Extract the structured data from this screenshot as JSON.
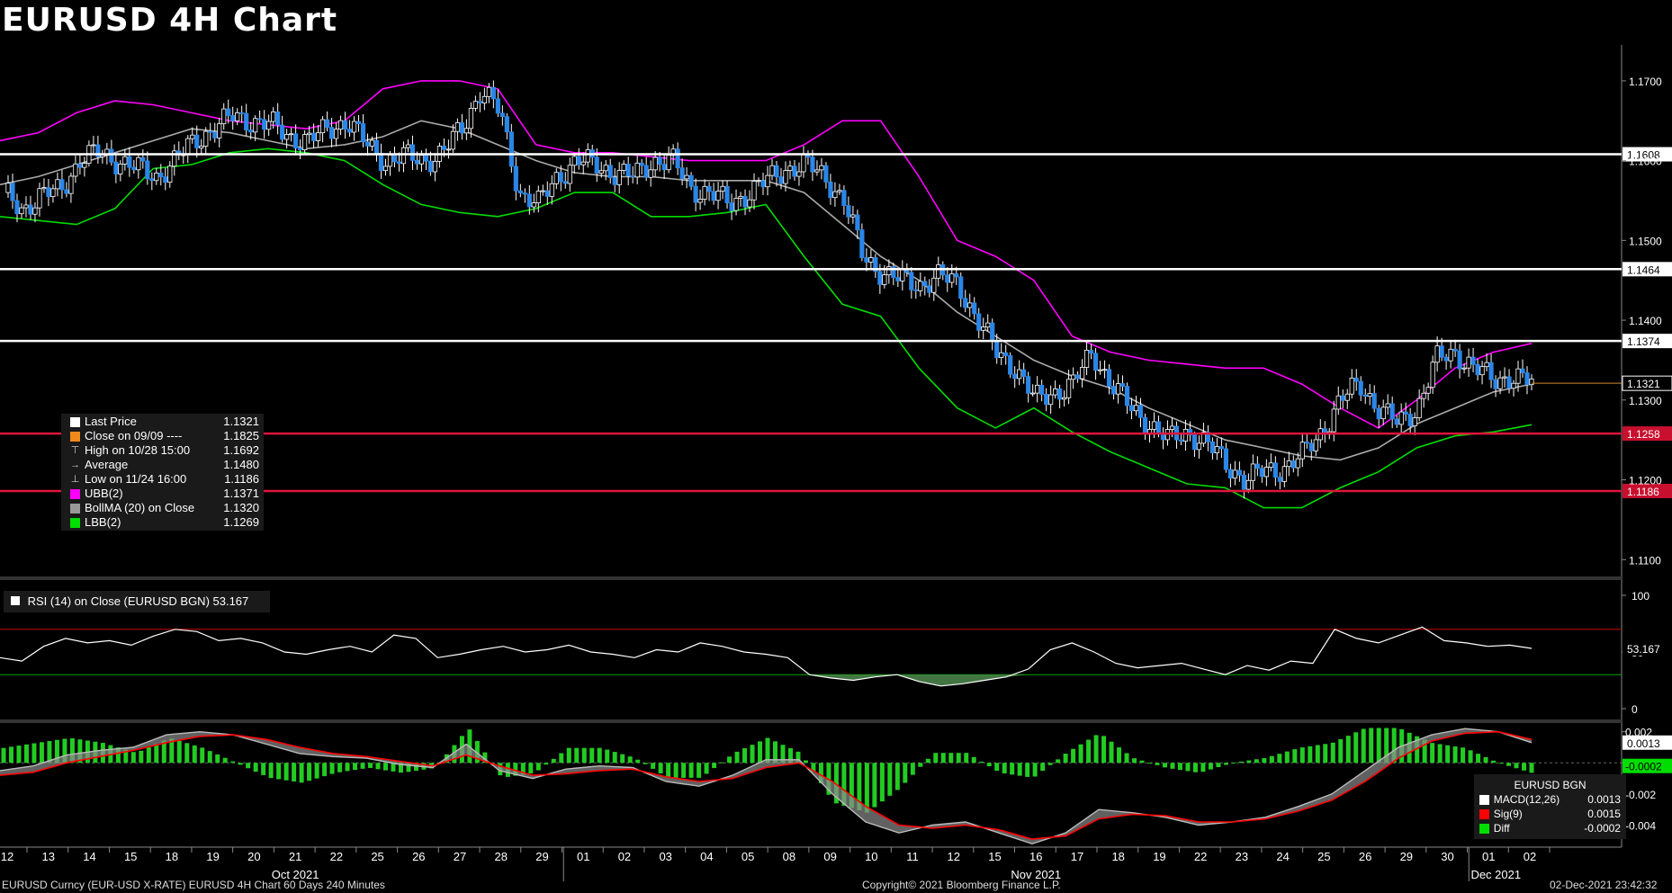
{
  "title": "EURUSD 4H Chart",
  "footer": {
    "left": "EURUSD Curncy (EUR-USD X-RATE) EURUSD 4H Chart 60 Days 240 Minutes",
    "center": "Copyright© 2021 Bloomberg Finance L.P.",
    "right": "02-Dec-2021 23:42:32"
  },
  "colors": {
    "up": "#ffffff",
    "down": "#2b86e6",
    "ubb": "#ff00ff",
    "lbb": "#00dd00",
    "bollma": "#aaaaaa",
    "hline": "#ffffff",
    "support": "#e0143c",
    "rsi_upper": "#cc0000",
    "rsi_lower": "#00aa00",
    "macd": "#bbbbbb",
    "sig": "#ff0000",
    "diff": "#22cc22"
  },
  "legend": [
    {
      "label": "Last Price",
      "value": "1.1321",
      "icon": "white-square"
    },
    {
      "label": "Close on 09/09 ----",
      "value": "1.1825",
      "icon": "orange-square"
    },
    {
      "label": "High on 10/28 15:00",
      "value": "1.1692",
      "icon": "high-marker"
    },
    {
      "label": "Average",
      "value": "1.1480",
      "icon": "average-marker"
    },
    {
      "label": "Low on 11/24 16:00",
      "value": "1.1186",
      "icon": "low-marker"
    },
    {
      "label": "UBB(2)",
      "value": "1.1371",
      "icon": "magenta-square"
    },
    {
      "label": "BollMA (20)  on Close",
      "value": "1.1320",
      "icon": "gray-square"
    },
    {
      "label": "LBB(2)",
      "value": "1.1269",
      "icon": "green-square"
    }
  ],
  "rsi_legend": "RSI (14)  on Close (EURUSD BGN) 53.167",
  "macd_legend": {
    "title": "EURUSD BGN",
    "rows": [
      {
        "label": "MACD(12,26)",
        "value": "0.0013"
      },
      {
        "label": "Sig(9)",
        "value": "0.0015"
      },
      {
        "label": "Diff",
        "value": "-0.0002"
      }
    ]
  },
  "chart_data": {
    "type": "candlestick",
    "title": "EURUSD 4H Chart",
    "x_tick_labels": [
      "12",
      "13",
      "14",
      "15",
      "18",
      "19",
      "20",
      "21",
      "22",
      "25",
      "26",
      "27",
      "28",
      "29",
      "01",
      "02",
      "03",
      "04",
      "05",
      "08",
      "09",
      "10",
      "11",
      "12",
      "15",
      "16",
      "17",
      "18",
      "19",
      "22",
      "23",
      "24",
      "25",
      "26",
      "29",
      "30",
      "01",
      "02"
    ],
    "x_month_labels": [
      "Oct 2021",
      "Nov 2021",
      "Dec 2021"
    ],
    "price_axis": {
      "ticks": [
        "1.1700",
        "1.1600",
        "1.1500",
        "1.1400",
        "1.1300",
        "1.1200",
        "1.1100"
      ],
      "ylim": [
        1.108,
        1.1745
      ]
    },
    "horizontal_levels": [
      {
        "value": 1.1608,
        "label": "1.1608",
        "color": "white"
      },
      {
        "value": 1.1464,
        "label": "1.1464",
        "color": "white"
      },
      {
        "value": 1.1374,
        "label": "1.1374",
        "color": "white"
      },
      {
        "value": 1.1258,
        "label": "1.1258",
        "color": "red"
      },
      {
        "value": 1.1186,
        "label": "1.1186",
        "color": "red"
      }
    ],
    "last_price_tag": "1.1321",
    "price_path": [
      1.156,
      1.154,
      1.1555,
      1.1565,
      1.16,
      1.161,
      1.16,
      1.159,
      1.158,
      1.16,
      1.1625,
      1.164,
      1.1655,
      1.165,
      1.1645,
      1.163,
      1.1625,
      1.164,
      1.165,
      1.162,
      1.16,
      1.1605,
      1.16,
      1.161,
      1.164,
      1.169,
      1.166,
      1.156,
      1.1545,
      1.158,
      1.16,
      1.1595,
      1.1585,
      1.158,
      1.16,
      1.16,
      1.1565,
      1.156,
      1.1545,
      1.156,
      1.1575,
      1.159,
      1.1595,
      1.158,
      1.155,
      1.148,
      1.146,
      1.145,
      1.1445,
      1.1455,
      1.1445,
      1.14,
      1.136,
      1.134,
      1.13,
      1.131,
      1.132,
      1.136,
      1.132,
      1.129,
      1.127,
      1.125,
      1.126,
      1.1245,
      1.122,
      1.12,
      1.121,
      1.1215,
      1.123,
      1.126,
      1.13,
      1.132,
      1.129,
      1.127,
      1.129,
      1.135,
      1.136,
      1.134,
      1.1325,
      1.133,
      1.1321
    ],
    "ubb_path": [
      1.1625,
      1.1635,
      1.166,
      1.1675,
      1.167,
      1.166,
      1.165,
      1.1645,
      1.164,
      1.165,
      1.169,
      1.17,
      1.17,
      1.169,
      1.162,
      1.161,
      1.161,
      1.1605,
      1.16,
      1.16,
      1.16,
      1.162,
      1.165,
      1.165,
      1.158,
      1.15,
      1.148,
      1.145,
      1.138,
      1.136,
      1.135,
      1.1345,
      1.134,
      1.134,
      1.132,
      1.129,
      1.1265,
      1.13,
      1.134,
      1.136,
      1.1371
    ],
    "bollma_path": [
      1.157,
      1.158,
      1.1595,
      1.161,
      1.1625,
      1.164,
      1.1635,
      1.1625,
      1.1615,
      1.162,
      1.163,
      1.165,
      1.164,
      1.162,
      1.16,
      1.1585,
      1.158,
      1.158,
      1.1575,
      1.1575,
      1.1575,
      1.156,
      1.152,
      1.148,
      1.145,
      1.141,
      1.138,
      1.135,
      1.133,
      1.1315,
      1.129,
      1.127,
      1.125,
      1.124,
      1.123,
      1.1225,
      1.124,
      1.127,
      1.129,
      1.131,
      1.132
    ],
    "lbb_path": [
      1.153,
      1.1525,
      1.152,
      1.154,
      1.159,
      1.1595,
      1.161,
      1.1615,
      1.161,
      1.16,
      1.157,
      1.1545,
      1.1535,
      1.153,
      1.154,
      1.156,
      1.156,
      1.153,
      1.153,
      1.1535,
      1.1545,
      1.148,
      1.142,
      1.1405,
      1.134,
      1.129,
      1.1265,
      1.129,
      1.126,
      1.1235,
      1.1215,
      1.1195,
      1.119,
      1.1165,
      1.1165,
      1.119,
      1.121,
      1.124,
      1.1255,
      1.126,
      1.1269
    ],
    "rsi": {
      "ticks": [
        "100",
        "50",
        "0"
      ],
      "ylim": [
        0,
        100
      ],
      "upper": 70,
      "lower": 30,
      "last": "53.167",
      "values": [
        45,
        42,
        55,
        62,
        58,
        60,
        56,
        64,
        70,
        68,
        60,
        62,
        58,
        50,
        48,
        52,
        55,
        50,
        65,
        62,
        45,
        48,
        52,
        55,
        50,
        52,
        56,
        50,
        48,
        45,
        52,
        50,
        58,
        55,
        50,
        48,
        45,
        30,
        27,
        25,
        28,
        30,
        24,
        20,
        22,
        25,
        28,
        35,
        52,
        58,
        50,
        40,
        36,
        38,
        40,
        35,
        30,
        38,
        34,
        42,
        40,
        70,
        62,
        58,
        65,
        72,
        60,
        58,
        55,
        56,
        53.167
      ]
    },
    "macd": {
      "ticks": [
        "0.002",
        "0.000",
        "-0.002",
        "-0.004"
      ],
      "ylim": [
        -0.0053,
        0.0025
      ],
      "macd_tag": "0.0013",
      "diff_tag": "-0.0002",
      "macd_values": [
        -0.0005,
        -0.0002,
        0.0005,
        0.0008,
        0.001,
        0.0018,
        0.002,
        0.0018,
        0.0012,
        0.0006,
        0.0004,
        0.0003,
        -0.0001,
        -0.0003,
        0.0012,
        -0.0005,
        -0.001,
        -0.0004,
        -0.0002,
        -0.0003,
        -0.0012,
        -0.0015,
        -0.0008,
        0.0002,
        0.0002,
        -0.002,
        -0.0038,
        -0.0045,
        -0.004,
        -0.0038,
        -0.0045,
        -0.0052,
        -0.0045,
        -0.003,
        -0.0032,
        -0.0035,
        -0.004,
        -0.0038,
        -0.0035,
        -0.0028,
        -0.002,
        -0.0005,
        0.001,
        0.0018,
        0.0022,
        0.002,
        0.0013
      ],
      "sig_values": [
        -0.0008,
        -0.0006,
        0.0,
        0.0004,
        0.0008,
        0.0013,
        0.0017,
        0.0018,
        0.0015,
        0.001,
        0.0006,
        0.0004,
        0.0001,
        -0.0002,
        0.0005,
        -0.0002,
        -0.0008,
        -0.0007,
        -0.0005,
        -0.0004,
        -0.0009,
        -0.0012,
        -0.001,
        -0.0003,
        0.0,
        -0.0012,
        -0.0028,
        -0.004,
        -0.0042,
        -0.004,
        -0.0043,
        -0.0049,
        -0.0047,
        -0.0036,
        -0.0033,
        -0.0034,
        -0.0038,
        -0.0038,
        -0.0036,
        -0.0031,
        -0.0024,
        -0.0012,
        0.0003,
        0.0014,
        0.0019,
        0.002,
        0.0015
      ]
    }
  }
}
